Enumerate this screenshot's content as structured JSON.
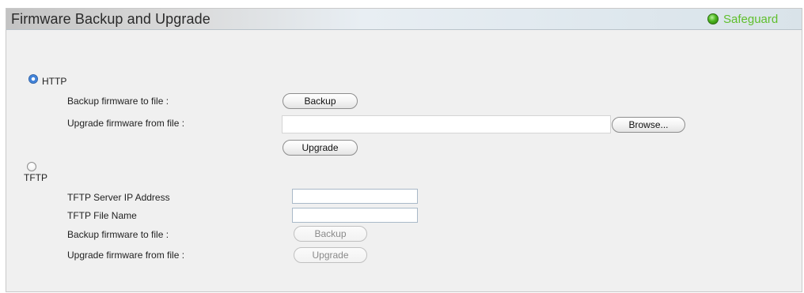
{
  "header": {
    "title": "Firmware Backup and Upgrade",
    "safeguard_label": "Safeguard",
    "safeguard_color": "#5fbf2c"
  },
  "http": {
    "label": "HTTP",
    "selected": true,
    "backup_label": "Backup firmware to file :",
    "backup_button": "Backup",
    "upgrade_label": "Upgrade firmware from file :",
    "file_value": "",
    "browse_button": "Browse...",
    "upgrade_button": "Upgrade"
  },
  "tftp": {
    "label": "TFTP",
    "selected": false,
    "server_ip_label": "TFTP Server IP Address",
    "server_ip_value": "",
    "file_name_label": "TFTP File Name",
    "file_name_value": "",
    "backup_label": "Backup firmware to file :",
    "backup_button": "Backup",
    "upgrade_label": "Upgrade firmware from file :",
    "upgrade_button": "Upgrade"
  }
}
